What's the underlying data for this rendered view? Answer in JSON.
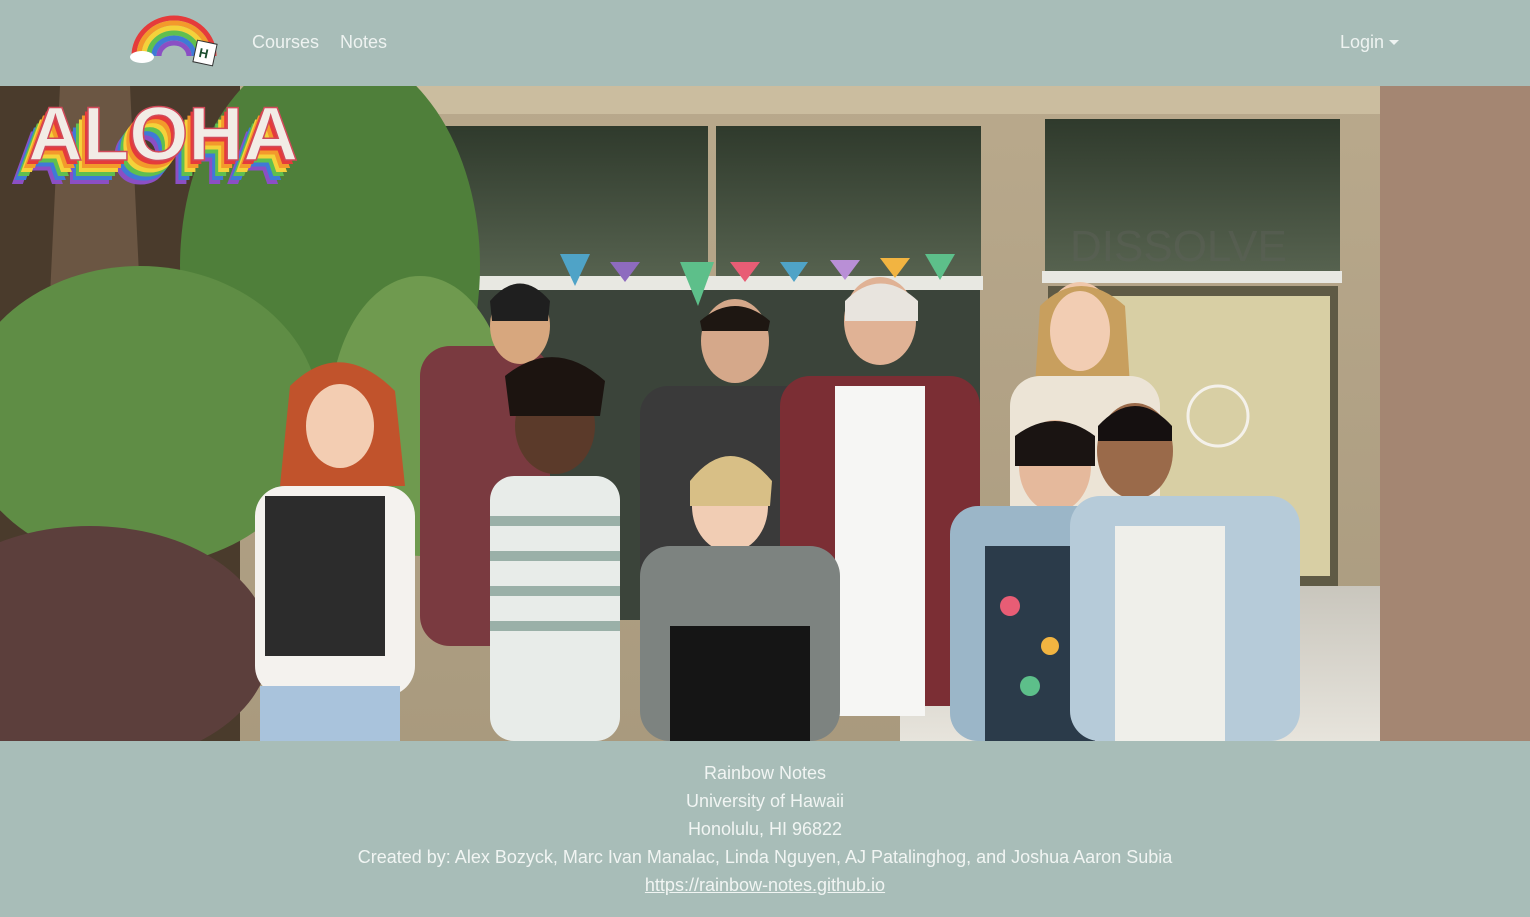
{
  "nav": {
    "logo_icon": "rainbow-hawaii-logo-icon",
    "items": [
      {
        "label": "Courses"
      },
      {
        "label": "Notes"
      }
    ],
    "login": {
      "label": "Login",
      "icon": "caret-down-icon"
    }
  },
  "hero": {
    "overlay_text": "ALOHA",
    "image_description_icon": "students-waving-photo"
  },
  "footer": {
    "lines": [
      "Rainbow Notes",
      "University of Hawaii",
      "Honolulu, HI 96822",
      "Created by: Alex Bozyck, Marc Ivan Manalac, Linda Nguyen, AJ Patalinghog, and Joshua Aaron Subia"
    ],
    "link": "https://rainbow-notes.github.io"
  },
  "colors": {
    "nav_bg": "#a8bdb8",
    "footer_bg": "#a8bdb8",
    "nav_text": "#eef3f1"
  }
}
